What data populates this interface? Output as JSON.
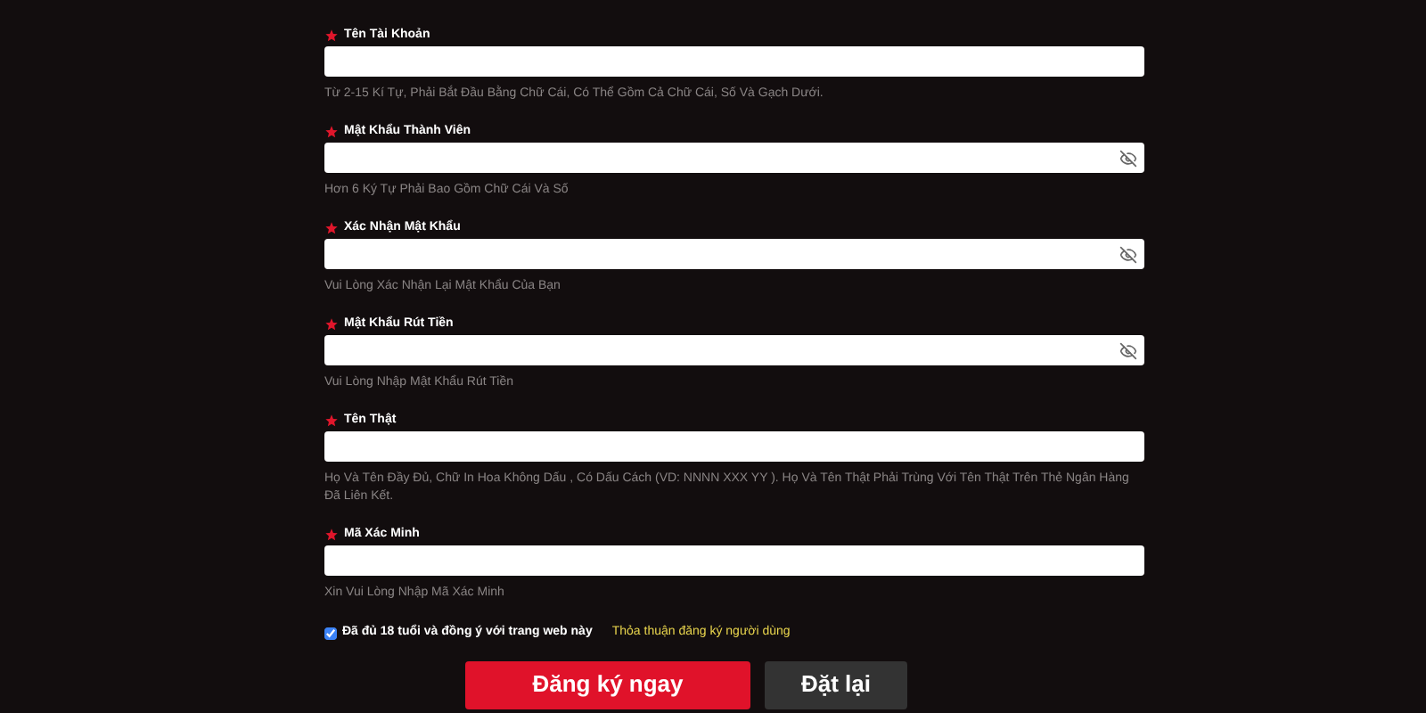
{
  "fields": [
    {
      "label": "Tên Tài Khoản",
      "kind": "text",
      "hint": "Từ 2-15 Kí Tự, Phải Bắt Đầu Bằng Chữ Cái, Có Thể Gồm Cả Chữ Cái, Số Và Gạch Dưới."
    },
    {
      "label": "Mật Khẩu Thành Viên",
      "kind": "password",
      "hint": "Hơn 6 Ký Tự Phải Bao Gồm Chữ Cái Và Số"
    },
    {
      "label": "Xác Nhận Mật Khẩu",
      "kind": "password",
      "hint": "Vui Lòng Xác Nhận Lại Mật Khẩu Của Bạn"
    },
    {
      "label": "Mật Khẩu Rút Tiền",
      "kind": "password",
      "hint": "Vui Lòng Nhập Mật Khẩu Rút Tiền"
    },
    {
      "label": "Tên Thật",
      "kind": "text",
      "hint": "Họ Và Tên Đầy Đủ, Chữ In Hoa Không Dấu , Có Dấu Cách (VD: NNNN XXX YY ). Họ Và Tên Thật Phải Trùng Với Tên Thật Trên Thẻ Ngân Hàng Đã Liên Kết."
    },
    {
      "label": "Mã Xác Minh",
      "kind": "text",
      "hint": "Xin Vui Lòng Nhập Mã Xác Minh"
    }
  ],
  "agreement": {
    "checked": true,
    "label": "Đã đủ 18 tuổi và đồng ý với trang web này",
    "link": "Thỏa thuận đăng ký người dùng"
  },
  "buttons": [
    {
      "label": "Đăng ký ngay",
      "kind": "primary"
    },
    {
      "label": "Đặt lại",
      "kind": "secondary"
    }
  ]
}
